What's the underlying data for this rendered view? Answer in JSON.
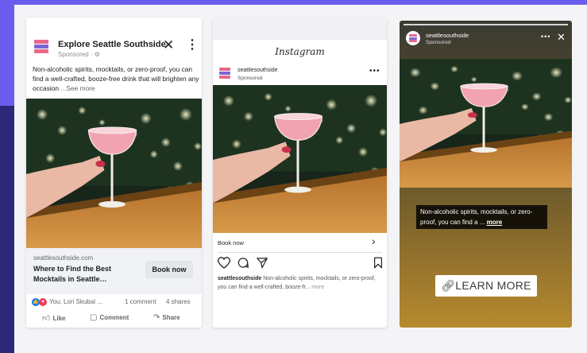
{
  "colors": {
    "page_accent": "#6b5cf0",
    "page_dark": "#2c2a78",
    "brand_pink": "#e8678a",
    "brand_purple": "#7e64d8",
    "facebook_blue": "#1877f2"
  },
  "facebook": {
    "page_name": "Explore Seattle Southside",
    "sponsored": "Sponsored · ⚙",
    "primary_text": "Non-alcoholic spirits, mocktails, or zero-proof, you can find a well-crafted, booze-free drink that will brighten any occasion",
    "see_more": " ...See more",
    "domain": "seattlesouthside.com",
    "headline": "Where to Find the Best Mocktails in Seattle…",
    "cta": "Book now",
    "reactions_names": "You, Lori Skubal ...",
    "comments": "1 comment",
    "shares": "4 shares",
    "actions": {
      "like": "Like",
      "comment": "Comment",
      "share": "Share"
    },
    "icons": [
      "brand-logo-icon",
      "close-icon",
      "more-icon",
      "like-reaction-icon",
      "love-reaction-icon",
      "thumbs-up-icon",
      "comment-icon",
      "share-icon"
    ]
  },
  "instagram_feed": {
    "brand": "Instagram",
    "username": "seattlesouthside",
    "sponsored": "Sponsored",
    "cta": "Book now",
    "caption_user": "seattlesouthside",
    "caption": " Non-alcoholic spirits, mocktails, or zero-proof, you can find a well-crafted, booze-fr...",
    "more": " more",
    "icons": [
      "heart-icon",
      "comment-icon",
      "send-icon",
      "bookmark-icon",
      "chevron-right-icon",
      "more-icon"
    ]
  },
  "instagram_story": {
    "username": "seattlesouthside",
    "sponsored": "Sponsored",
    "overlay_text": "Non-alcoholic spirits, mocktails, or zero-proof, you can find a ... ",
    "overlay_more": "more",
    "cta": "LEARN MORE",
    "icons": [
      "link-icon",
      "more-icon",
      "close-icon"
    ]
  }
}
